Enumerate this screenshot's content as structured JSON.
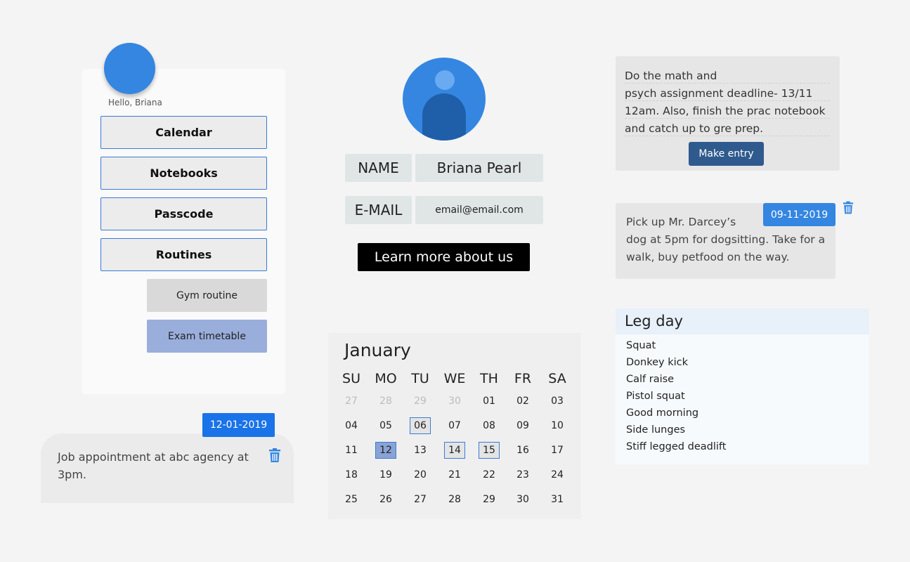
{
  "sidebar": {
    "greeting": "Hello, Briana",
    "items": [
      {
        "label": "Calendar"
      },
      {
        "label": "Notebooks"
      },
      {
        "label": "Passcode"
      },
      {
        "label": "Routines"
      }
    ],
    "sub_items": [
      {
        "label": "Gym routine"
      },
      {
        "label": "Exam timetable"
      }
    ]
  },
  "job_note": {
    "date": "12-01-2019",
    "text": "Job appointment at abc agency at 3pm.",
    "delete_icon": "trash-icon"
  },
  "profile": {
    "name_label": "NAME",
    "name_value": "Briana Pearl",
    "email_label": "E-MAIL",
    "email_value": "email@email.com",
    "learn_more": "Learn more about us"
  },
  "calendar": {
    "month": "January",
    "weekdays": [
      "SU",
      "MO",
      "TU",
      "WE",
      "TH",
      "FR",
      "SA"
    ],
    "weeks": [
      [
        {
          "d": "27",
          "muted": true
        },
        {
          "d": "28",
          "muted": true
        },
        {
          "d": "29",
          "muted": true
        },
        {
          "d": "30",
          "muted": true
        },
        {
          "d": "01"
        },
        {
          "d": "02"
        },
        {
          "d": "03"
        }
      ],
      [
        {
          "d": "04"
        },
        {
          "d": "05"
        },
        {
          "d": "06",
          "outlined": true
        },
        {
          "d": "07"
        },
        {
          "d": "08"
        },
        {
          "d": "09"
        },
        {
          "d": "10"
        }
      ],
      [
        {
          "d": "11"
        },
        {
          "d": "12",
          "selected": true
        },
        {
          "d": "13"
        },
        {
          "d": "14",
          "outlined": true
        },
        {
          "d": "15",
          "outlined": true
        },
        {
          "d": "16"
        },
        {
          "d": "17"
        }
      ],
      [
        {
          "d": "18"
        },
        {
          "d": "19"
        },
        {
          "d": "20"
        },
        {
          "d": "21"
        },
        {
          "d": "22"
        },
        {
          "d": "23"
        },
        {
          "d": "24"
        }
      ],
      [
        {
          "d": "25"
        },
        {
          "d": "26"
        },
        {
          "d": "27"
        },
        {
          "d": "28"
        },
        {
          "d": "29"
        },
        {
          "d": "30"
        },
        {
          "d": "31"
        }
      ]
    ]
  },
  "note_entry": {
    "lines": [
      "Do the math and",
      "psych assignment deadline- 13/11",
      "12am. Also, finish the prac notebook",
      "and catch up to gre prep."
    ],
    "button": "Make entry"
  },
  "note_dog": {
    "date": "09-11-2019",
    "lines": [
      "Pick up Mr. Darcey’s",
      "dog at 5pm for dogsitting. Take for a",
      "walk, buy petfood on the way."
    ],
    "delete_icon": "trash-icon"
  },
  "routine": {
    "title": "Leg day",
    "items": [
      "Squat",
      "Donkey kick",
      "Calf raise",
      "Pistol squat",
      "Good morning",
      "Side lunges",
      "Stiff legged deadlift"
    ]
  },
  "colors": {
    "accent": "#3486e1",
    "button_dark": "#2f5a8d",
    "selected_day": "#8aa3d6"
  }
}
